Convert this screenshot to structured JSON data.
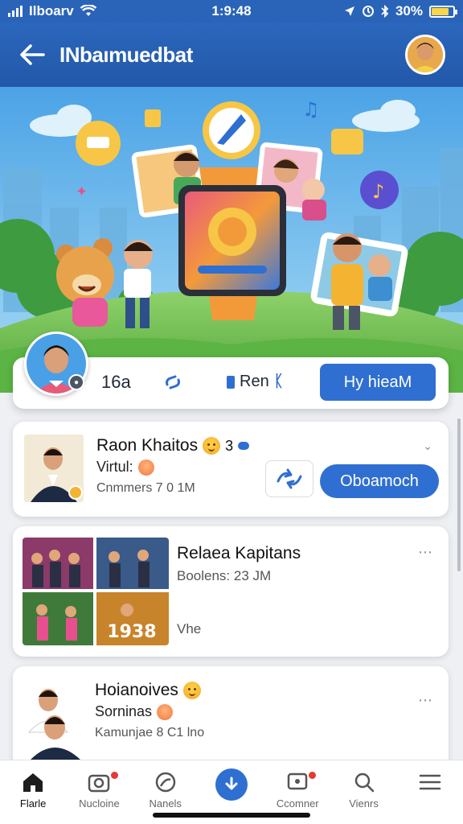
{
  "status_bar": {
    "carrier": "Ilboarv",
    "time": "1:9:48",
    "battery_percent": "30%",
    "battery_level": 0.8,
    "icons": [
      "signal-icon",
      "wifi-icon",
      "location-icon",
      "alarm-icon",
      "bluetooth-icon",
      "battery-icon"
    ]
  },
  "header": {
    "title": "INbaımuedbat",
    "back_icon": "arrow-left-icon"
  },
  "profile": {
    "count": "16a",
    "tag": "Ren",
    "action_label": "Hy hieaM"
  },
  "feed": [
    {
      "title": "Raon Khaitos",
      "title_extra": "3",
      "subtitle": "Virtul:",
      "meta": "Cnmmers 7 0 1M",
      "button_label": "Oboamoch"
    },
    {
      "title": "Relaea Kapitans",
      "subtitle": "Boolens: 23 JM",
      "extra": "Vhe",
      "thumb_text": "1938"
    },
    {
      "title": "Hoianoives",
      "subtitle": "Sorninas",
      "meta": "Kamunjae 8 C1 lno"
    }
  ],
  "bottom_nav": [
    {
      "label": "Flarle",
      "icon": "home-icon",
      "active": true
    },
    {
      "label": "Nucloine",
      "icon": "camera-icon",
      "badge": true
    },
    {
      "label": "Nanels",
      "icon": "globe-icon"
    },
    {
      "label": "",
      "icon": "download-icon",
      "center": true
    },
    {
      "label": "Ccomner",
      "icon": "chat-icon",
      "badge": true
    },
    {
      "label": "Vienrs",
      "icon": "search-icon"
    },
    {
      "label": "",
      "icon": "menu-icon"
    }
  ],
  "colors": {
    "primary": "#2f6fd1",
    "header": "#2b67bd",
    "badge": "#e53935"
  }
}
